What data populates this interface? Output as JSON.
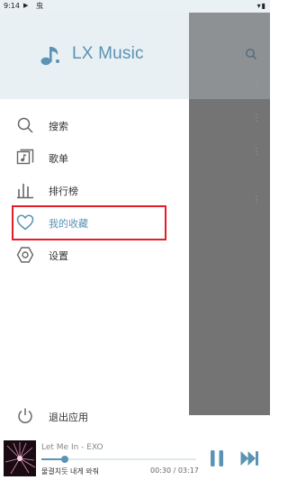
{
  "status_bar": {
    "time": "9:14",
    "play_glyph": "▶",
    "app_glyph": "虫",
    "right_glyphs": "▾▮"
  },
  "app": {
    "name": "LX Music",
    "accent": "#5a93b3",
    "logo_icon": "music-note-icon"
  },
  "menu": {
    "items": [
      {
        "label": "搜索",
        "icon": "search-icon",
        "active": false
      },
      {
        "label": "歌单",
        "icon": "playlist-icon",
        "active": false
      },
      {
        "label": "排行榜",
        "icon": "leaderboard-icon",
        "active": false
      },
      {
        "label": "我的收藏",
        "icon": "heart-icon",
        "active": true
      },
      {
        "label": "设置",
        "icon": "settings-icon",
        "active": false
      }
    ],
    "exit_label": "退出应用",
    "exit_icon": "power-icon"
  },
  "player": {
    "song_title": "Let Me In - EXO",
    "lyric": "물결치듯 내게 와줘",
    "time_display": "00:30 / 03:17",
    "progress": 0.15,
    "pause_icon": "pause-icon",
    "next_icon": "skip-next-icon"
  }
}
